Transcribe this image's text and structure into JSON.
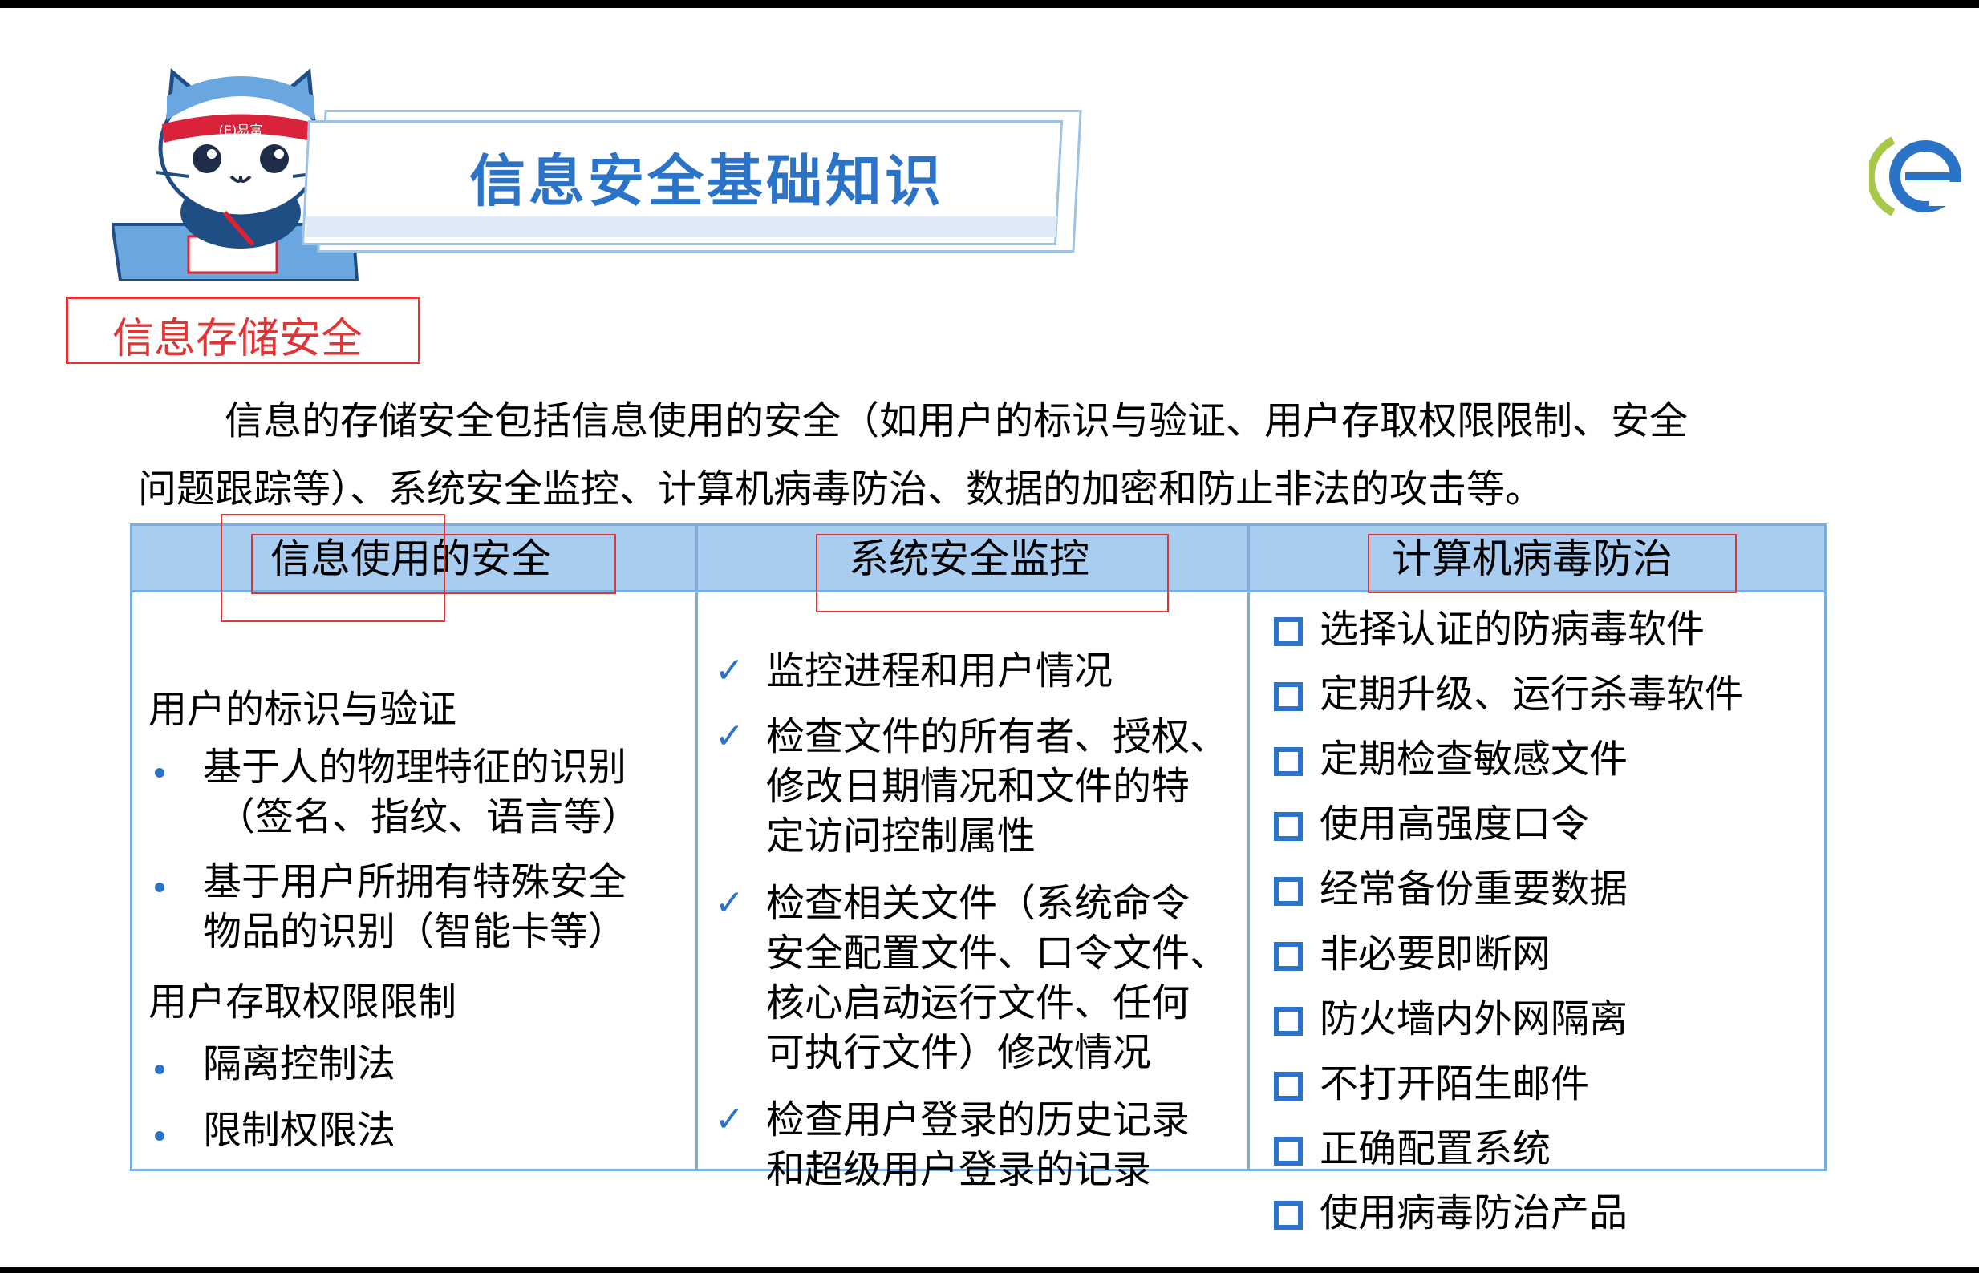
{
  "slide": {
    "title": "信息安全基础知识",
    "mascot_band_text": "(E)易富",
    "section_label": "信息存储安全",
    "intro_line1": "信息的存储安全包括信息使用的安全（如用户的标识与验证、用户存取权限限制、安全",
    "intro_line2": "问题跟踪等）、系统安全监控、计算机病毒防治、数据的加密和防止非法的攻击等。"
  },
  "table": {
    "headers": [
      "信息使用的安全",
      "系统安全监控",
      "计算机病毒防治"
    ],
    "col1": {
      "heading1": "用户的标识与验证",
      "b1_line1": "基于人的物理特征的识别",
      "b1_line2": "（签名、指纹、语言等）",
      "b2_line1": "基于用户所拥有特殊安全",
      "b2_line2": "物品的识别（智能卡等）",
      "heading2": "用户存取权限限制",
      "b3": "隔离控制法",
      "b4": "限制权限法"
    },
    "col2": {
      "i1": "监控进程和用户情况",
      "i2_line1": "检查文件的所有者、授权、",
      "i2_line2": "修改日期情况和文件的特",
      "i2_line3": "定访问控制属性",
      "i3_line1": "检查相关文件（系统命令",
      "i3_line2": "安全配置文件、口令文件、",
      "i3_line3": "核心启动运行文件、任何",
      "i3_line4": "可执行文件）修改情况",
      "i4_line1": "检查用户登录的历史记录",
      "i4_line2": "和超级用户登录的记录",
      "check_mark": "✓"
    },
    "col3": [
      "选择认证的防病毒软件",
      "定期升级、运行杀毒软件",
      "定期检查敏感文件",
      "使用高强度口令",
      "经常备份重要数据",
      "非必要即断网",
      "防火墙内外网隔离",
      "不打开陌生邮件",
      "正确配置系统",
      "使用病毒防治产品"
    ]
  },
  "colors": {
    "accent_blue": "#2a73c6",
    "header_fill": "#a9cdf0",
    "border_blue": "#7aaee0",
    "highlight_red": "#e03535"
  },
  "icons": {
    "mascot": "cat-mascot-illustration",
    "logo": "e-logo-icon",
    "bullet": "bullet-dot-icon",
    "check": "check-icon",
    "square": "square-bullet-icon"
  }
}
